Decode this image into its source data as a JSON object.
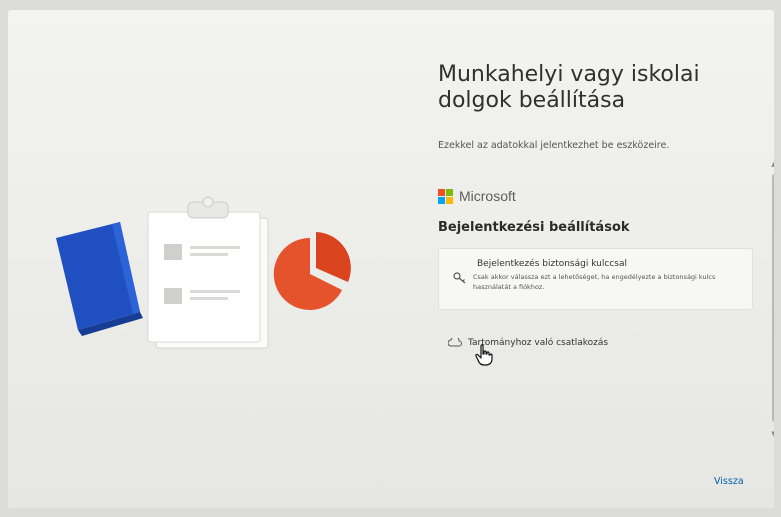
{
  "page": {
    "title": "Munkahelyi vagy iskolai dolgok beállítása",
    "subtitle": "Ezekkel az adatokkal jelentkezhet be eszközeire."
  },
  "brand": {
    "name": "Microsoft"
  },
  "signin": {
    "section_title": "Bejelentkezési beállítások",
    "option": {
      "title": "Bejelentkezés biztonsági kulccsal",
      "description": "Csak akkor válassza ezt a lehetőséget, ha engedélyezte a biztonsági kulcs használatát a fiókhoz."
    },
    "domain_link": "Tartományhoz való csatlakozás"
  },
  "nav": {
    "back_label": "Vissza"
  },
  "colors": {
    "accent": "#0063b1",
    "ms_red": "#f25022",
    "ms_green": "#7fba00",
    "ms_blue": "#00a4ef",
    "ms_yellow": "#ffb900"
  },
  "icons": [
    "notebook-illustration",
    "clipboard-illustration",
    "pie-chart-illustration",
    "key-icon",
    "domain-icon",
    "hand-cursor-icon"
  ]
}
